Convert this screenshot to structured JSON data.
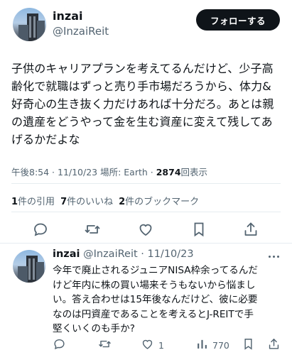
{
  "tweet": {
    "author_name": "inzai",
    "author_handle": "@InzaiReit",
    "follow_label": "フォローする",
    "text_lines": [
      "子供のキャリアプランを考えてるんだけど、少子高",
      "齢化で就職はずっと売り手市場だろうから、体力&",
      "好奇心の生き抜く力だけあれば十分だろ。あとは親",
      "の遺産をどうやって金を生む資産に変えて残してあ",
      "げるかだよな"
    ],
    "meta_prefix": "午後8:54 · 11/10/23 場所: Earth · ",
    "views_count": "2874",
    "views_label": "回表示",
    "stats": {
      "quotes_count": "1",
      "quotes_label": "件の引用",
      "likes_count": "7",
      "likes_label": "件のいいね",
      "bookmarks_count": "2",
      "bookmarks_label": "件のブックマーク"
    }
  },
  "actions": [
    {
      "icon": "reply-icon"
    },
    {
      "icon": "retweet-icon"
    },
    {
      "icon": "like-icon"
    },
    {
      "icon": "bookmark-icon"
    },
    {
      "icon": "share-icon"
    }
  ],
  "reply": {
    "author_name": "inzai",
    "author_meta": "@InzaiReit · 11/10/23",
    "text_lines": [
      "今年で廃止されるジュニアNISA枠余ってるんだ",
      "けど年内に株の買い場来そうもないから悩まし",
      "い。答え合わせは15年後なんだけど、彼に必要",
      "なのは円資産であることを考えるとJ-REITで手",
      "堅くいくのも手か?"
    ],
    "actions": {
      "reply_count": "",
      "retweet_count": "",
      "like_count": "1",
      "views_count": "770"
    }
  },
  "colors": {
    "text": "#0f1419",
    "secondary": "#536471",
    "follow_bg": "#0f1419",
    "divider": "#e6ecf0"
  }
}
